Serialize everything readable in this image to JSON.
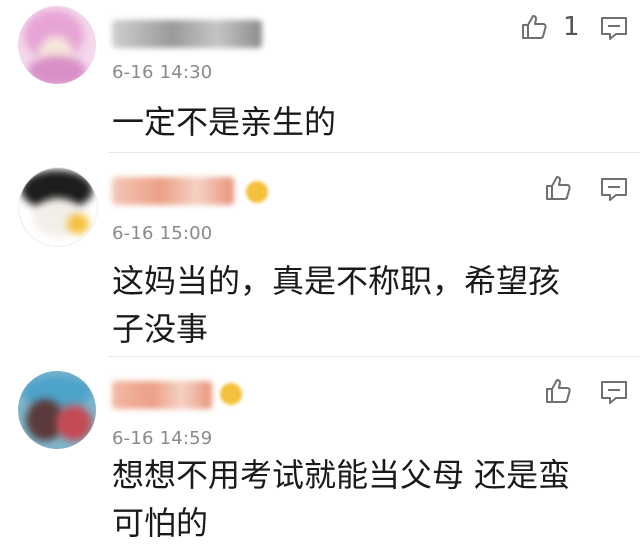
{
  "comments": [
    {
      "time": "6-16 14:30",
      "text": "一定不是亲生的",
      "likes": "1",
      "avatar_icon": "avatar-pink-blurred",
      "has_vip_badge": false
    },
    {
      "time": "6-16 15:00",
      "text_line1": "这妈当的，真是不称职，希望孩",
      "text_line2": "子没事",
      "likes": "",
      "avatar_icon": "avatar-cartoon-blurred",
      "has_vip_badge": true
    },
    {
      "time": "6-16 14:59",
      "text_line1": "想想不用考试就能当父母 还是蛮",
      "text_line2": "可怕的",
      "likes": "",
      "avatar_icon": "avatar-blue-blurred",
      "has_vip_badge": true
    }
  ],
  "icons": {
    "like": "thumbs-up-icon",
    "reply": "comment-icon"
  },
  "colors": {
    "text": "#1a1a1a",
    "time": "#8a8a8a",
    "icon": "#707070",
    "divider": "#e6e6e6",
    "vip": "#f3c13a"
  }
}
